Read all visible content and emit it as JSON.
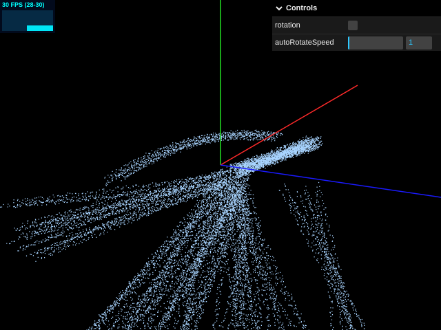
{
  "stats": {
    "fps_text": "30 FPS (28-30)",
    "fps": 30,
    "fps_min": 28,
    "fps_max": 30,
    "text_color": "#00ffff",
    "bg_color": "#020a1c"
  },
  "gui": {
    "title": "Controls",
    "title_icon": "chevron-down-icon",
    "controls": [
      {
        "label": "rotation",
        "type": "checkbox",
        "checked": false
      },
      {
        "label": "autoRotateSpeed",
        "type": "slider",
        "value": "1",
        "fill_fraction": 0.02
      }
    ],
    "accent_color": "#2cc9ff",
    "bg_color": "#1a1a1a"
  },
  "scene": {
    "type": "3d-point-cloud",
    "point_color": "#a8d4ff",
    "axes": [
      {
        "name": "x",
        "color": "#ff2a2a"
      },
      {
        "name": "y",
        "color": "#22dd22"
      },
      {
        "name": "z",
        "color": "#1a1aff"
      }
    ]
  }
}
